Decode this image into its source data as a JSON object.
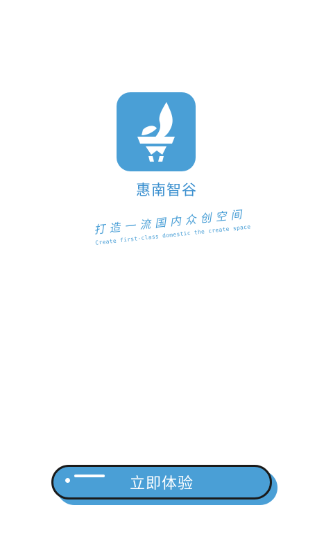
{
  "app": {
    "name": "惠南智谷",
    "logo_icon": "torch-icon",
    "brand_color": "#4a9fd6"
  },
  "slogan": {
    "chinese": "打造一流国内众创空间",
    "english": "Create first-class domestic the create space"
  },
  "cta": {
    "label": "立即体验"
  }
}
